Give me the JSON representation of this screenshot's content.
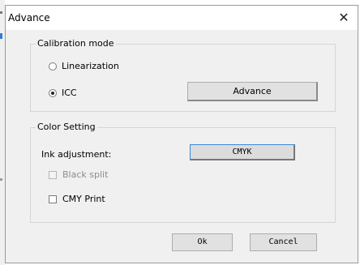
{
  "window": {
    "title": "Advance",
    "close_glyph": "✕"
  },
  "calibration": {
    "group_label": "Calibration mode",
    "options": [
      {
        "label": "Linearization",
        "selected": false
      },
      {
        "label": "ICC",
        "selected": true
      }
    ],
    "advance_button": "Advance"
  },
  "color_setting": {
    "group_label": "Color Setting",
    "ink_adjustment_label": "Ink adjustment:",
    "ink_button": "CMYK",
    "black_split": {
      "label": "Black split",
      "checked": false,
      "disabled": true
    },
    "cmy_print": {
      "label": "CMY Print",
      "checked": false,
      "disabled": false
    }
  },
  "footer": {
    "ok": "Ok",
    "cancel": "Cancel"
  },
  "colors": {
    "focus_border": "#3c8ad6",
    "dialog_bg": "#f0f0f0",
    "disabled_text": "#8c8c8c"
  },
  "icons": {
    "close": "close-icon",
    "radio_selected": "radio-selected-icon",
    "radio_unselected": "radio-unselected-icon",
    "checkbox": "checkbox-icon"
  }
}
